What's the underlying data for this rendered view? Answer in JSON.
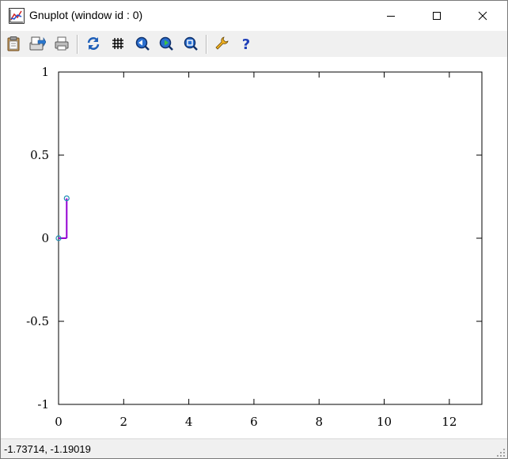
{
  "window": {
    "title": "Gnuplot (window id : 0)"
  },
  "toolbar": {
    "items": [
      {
        "icon": "clipboard-icon"
      },
      {
        "icon": "export-icon"
      },
      {
        "icon": "print-icon"
      },
      {
        "icon": "replot-icon"
      },
      {
        "icon": "grid-icon"
      },
      {
        "icon": "zoom-previous-icon"
      },
      {
        "icon": "zoom-next-icon"
      },
      {
        "icon": "autoscale-icon"
      },
      {
        "icon": "options-icon"
      },
      {
        "icon": "help-icon"
      }
    ]
  },
  "chart_data": {
    "type": "line",
    "xlim": [
      0,
      13
    ],
    "ylim": [
      -1,
      1
    ],
    "xticks": [
      "0",
      "2",
      "4",
      "6",
      "8",
      "10",
      "12"
    ],
    "yticks": [
      "1",
      "0.5",
      "0",
      "-0.5",
      "-1"
    ],
    "series": [
      {
        "color": "#9400d3",
        "marker_color": "#1e8cb4",
        "segments": [
          [
            [
              0,
              0
            ],
            [
              0.25,
              0
            ]
          ],
          [
            [
              0.25,
              0
            ],
            [
              0.25,
              0.24
            ]
          ]
        ],
        "points": [
          [
            0,
            0
          ],
          [
            0.25,
            0.24
          ]
        ]
      }
    ],
    "grid": false
  },
  "status": {
    "coords": "-1.73714, -1.19019"
  }
}
